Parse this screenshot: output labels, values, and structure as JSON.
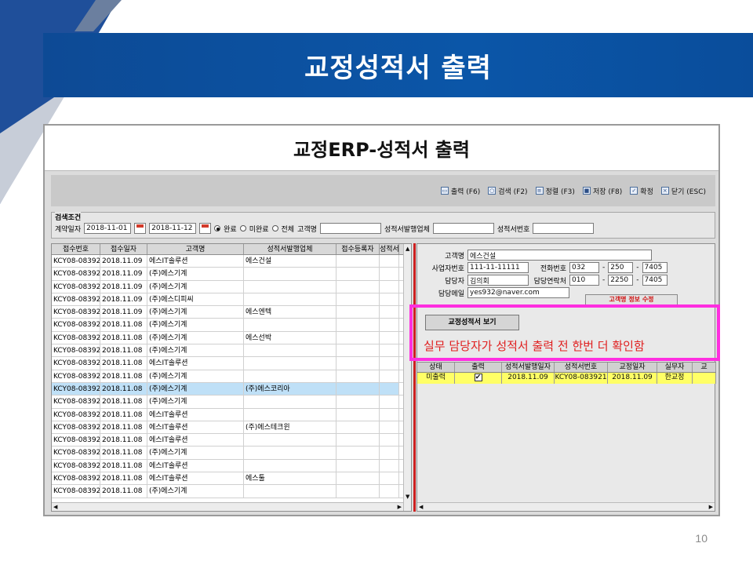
{
  "slide": {
    "title": "교정성적서 출력",
    "page_number": "10",
    "accent_color": "#0b56a8"
  },
  "app": {
    "title": "교정ERP-성적서 출력",
    "toolbar": [
      {
        "label": "출력 (F6)",
        "icon": "printer-icon"
      },
      {
        "label": "검색 (F2)",
        "icon": "search-icon"
      },
      {
        "label": "정렬 (F3)",
        "icon": "sort-icon"
      },
      {
        "label": "저장 (F8)",
        "icon": "save-icon"
      },
      {
        "label": "확정",
        "icon": "confirm-icon"
      },
      {
        "label": "닫기 (ESC)",
        "icon": "close-icon"
      }
    ],
    "search": {
      "title": "검색조건",
      "contract_label": "계약일자",
      "date_from": "2018-11-01",
      "date_to": "2018-11-12",
      "radio_done": "완료",
      "radio_undone": "미완료",
      "radio_all": "전체",
      "customer_label": "고객명",
      "issuer_label": "성적서발행업체",
      "cert_no_label": "성적서번호"
    },
    "left_grid": {
      "headers": [
        "접수번호",
        "접수일자",
        "고객명",
        "성적서발행업체",
        "접수등록자",
        "성적서"
      ],
      "rows": [
        [
          "KCY08-083921",
          "2018.11.09",
          "에스IT솔루션",
          "에스건설"
        ],
        [
          "KCY08-083921",
          "2018.11.09",
          "(주)에스기계",
          ""
        ],
        [
          "KCY08-083921",
          "2018.11.09",
          "(주)에스기계",
          ""
        ],
        [
          "KCY08-083921",
          "2018.11.09",
          "(주)에스디피씨",
          ""
        ],
        [
          "KCY08-083921",
          "2018.11.09",
          "(주)에스기계",
          "에스엔텍"
        ],
        [
          "KCY08-083921",
          "2018.11.08",
          "(주)에스기계",
          ""
        ],
        [
          "KCY08-083921",
          "2018.11.08",
          "(주)에스기계",
          "에스선박"
        ],
        [
          "KCY08-083921",
          "2018.11.08",
          "(주)에스기계",
          ""
        ],
        [
          "KCY08-083921",
          "2018.11.08",
          "에스IT솔루션",
          ""
        ],
        [
          "KCY08-083921",
          "2018.11.08",
          "(주)에스기계",
          ""
        ],
        [
          "KCY08-083921",
          "2018.11.08",
          "(주)에스기계",
          "(주)에스코리아"
        ],
        [
          "KCY08-083921",
          "2018.11.08",
          "(주)에스기계",
          ""
        ],
        [
          "KCY08-083921",
          "2018.11.08",
          "에스IT솔루션",
          ""
        ],
        [
          "KCY08-083921",
          "2018.11.08",
          "에스IT솔루션",
          "(주)에스테크윈"
        ],
        [
          "KCY08-083921",
          "2018.11.08",
          "에스IT솔루션",
          ""
        ],
        [
          "KCY08-083921",
          "2018.11.08",
          "(주)에스기계",
          ""
        ],
        [
          "KCY08-083921",
          "2018.11.08",
          "에스IT솔루션",
          ""
        ],
        [
          "KCY08-083921",
          "2018.11.08",
          "에스IT솔루션",
          "에스툴"
        ],
        [
          "KCY08-083921",
          "2018.11.08",
          "(주)에스기계",
          ""
        ]
      ],
      "selected_row": 10
    },
    "right": {
      "customer_label": "고객명",
      "customer": "에스건설",
      "bizno_label": "사업자번호",
      "bizno": "111-11-11111",
      "phone_label": "전화번호",
      "phone1": "032",
      "phone2": "250",
      "phone3": "7405",
      "manager_label": "담당자",
      "manager": "김의회",
      "contact_label": "담당연락처",
      "contact1": "010",
      "contact2": "2250",
      "contact3": "7405",
      "email_label": "담당메일",
      "email": "yes932@naver.com",
      "edit_button": "고객명 정보 수정",
      "view_button": "교정성적서 보기",
      "callout": "실무 담당자가 성적서 출력 전 한번 더 확인함",
      "grid_headers": [
        "상태",
        "출력",
        "성적서발행일자",
        "성적서번호",
        "교정일자",
        "실무자",
        "교"
      ],
      "grid_row": {
        "status": "미출력",
        "printed": "✔",
        "issue_date": "2018.11.09",
        "cert_no": "KCY08-083921",
        "calib_date": "2018.11.09",
        "worker": "한교정"
      }
    }
  }
}
